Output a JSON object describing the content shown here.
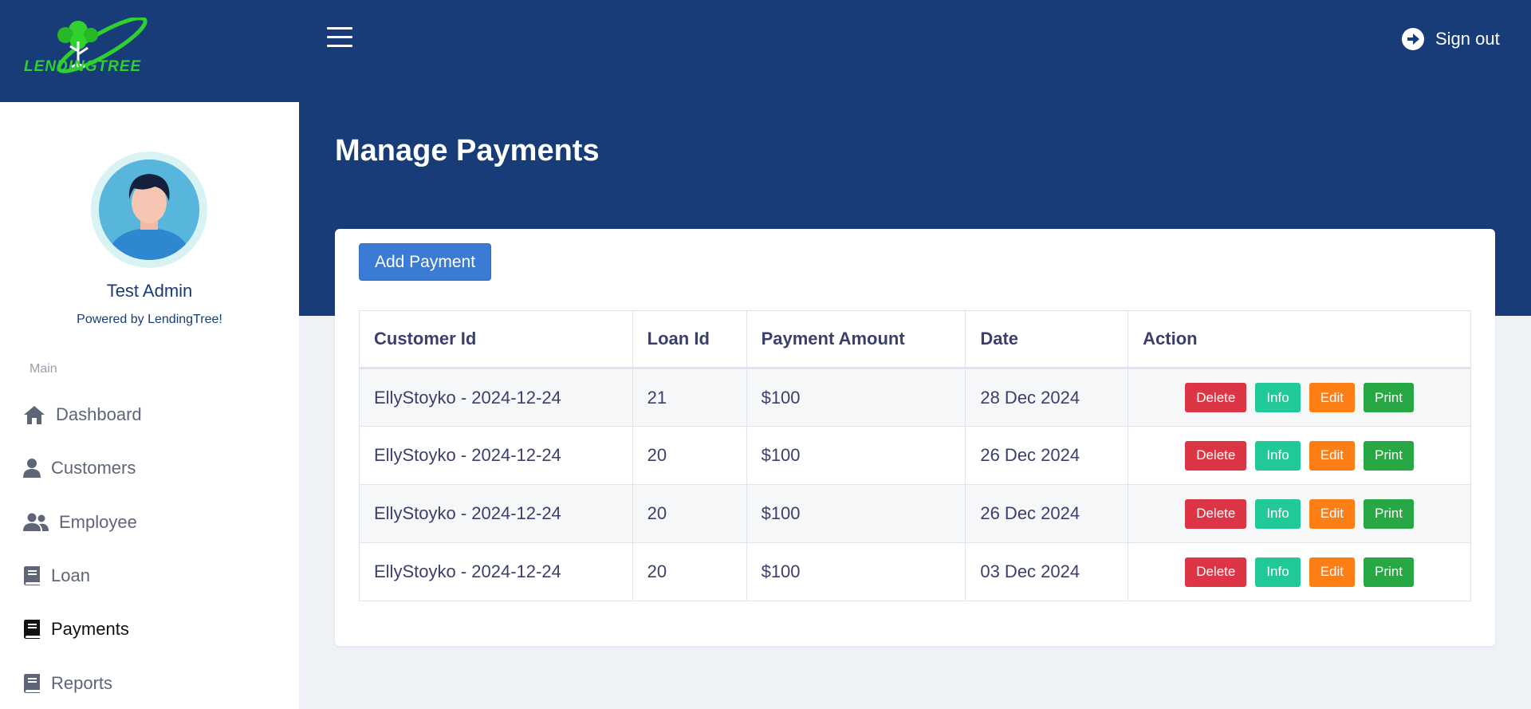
{
  "brand": {
    "logo_text": "LENDINGTREE"
  },
  "header": {
    "signout_label": "Sign out"
  },
  "profile": {
    "name": "Test Admin",
    "tagline": "Powered by LendingTree!"
  },
  "sidebar": {
    "section_label": "Main",
    "items": [
      {
        "label": "Dashboard",
        "icon": "home-icon"
      },
      {
        "label": "Customers",
        "icon": "user-icon"
      },
      {
        "label": "Employee",
        "icon": "users-icon"
      },
      {
        "label": "Loan",
        "icon": "book-icon"
      },
      {
        "label": "Payments",
        "icon": "book-icon",
        "active": true
      },
      {
        "label": "Reports",
        "icon": "book-icon"
      }
    ]
  },
  "main": {
    "title": "Manage Payments",
    "add_button": "Add Payment",
    "table": {
      "headers": [
        "Customer Id",
        "Loan Id",
        "Payment Amount",
        "Date",
        "Action"
      ],
      "rows": [
        [
          "EllyStoyko - 2024-12-24",
          "21",
          "$100",
          "28 Dec 2024"
        ],
        [
          "EllyStoyko - 2024-12-24",
          "20",
          "$100",
          "26 Dec 2024"
        ],
        [
          "EllyStoyko - 2024-12-24",
          "20",
          "$100",
          "26 Dec 2024"
        ],
        [
          "EllyStoyko - 2024-12-24",
          "20",
          "$100",
          "03 Dec 2024"
        ]
      ],
      "actions": {
        "delete": "Delete",
        "info": "Info",
        "edit": "Edit",
        "print": "Print"
      }
    }
  },
  "colors": {
    "navy": "#173c77",
    "primary": "#3a7bd5",
    "danger": "#dc3545",
    "info": "#20c997",
    "warning": "#fd7e14",
    "success": "#28a745"
  }
}
